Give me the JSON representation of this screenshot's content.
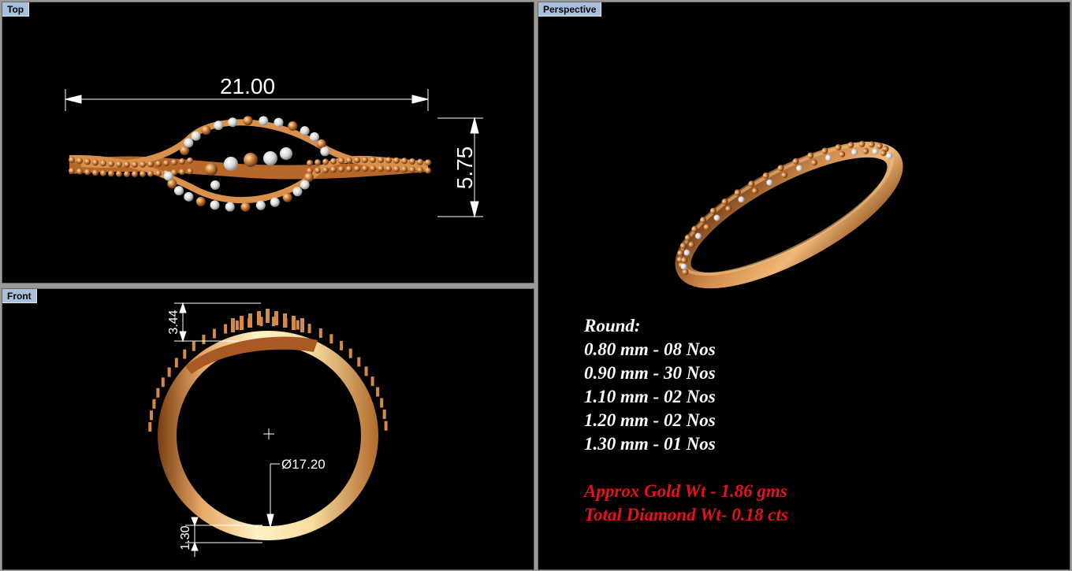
{
  "viewports": {
    "top": {
      "label": "Top"
    },
    "front": {
      "label": "Front"
    },
    "perspective": {
      "label": "Perspective"
    }
  },
  "dimensions": {
    "width": "21.00",
    "height": "5.75",
    "top_height": "3.44",
    "diameter": "Ø17.20",
    "band_thickness": "1.30"
  },
  "specs": {
    "heading": "Round:",
    "lines": [
      "0.80 mm - 08 Nos",
      "0.90 mm - 30 Nos",
      "1.10 mm - 02 Nos",
      "1.20 mm - 02 Nos",
      "1.30 mm - 01 Nos"
    ],
    "gold_weight": "Approx Gold Wt - 1.86 gms",
    "diamond_weight": "Total Diamond Wt- 0.18 cts"
  },
  "colors": {
    "background": "#000000",
    "label_bg": "#a8c0dc",
    "gold": "#c8783a",
    "highlight_text": "#e8101a"
  }
}
